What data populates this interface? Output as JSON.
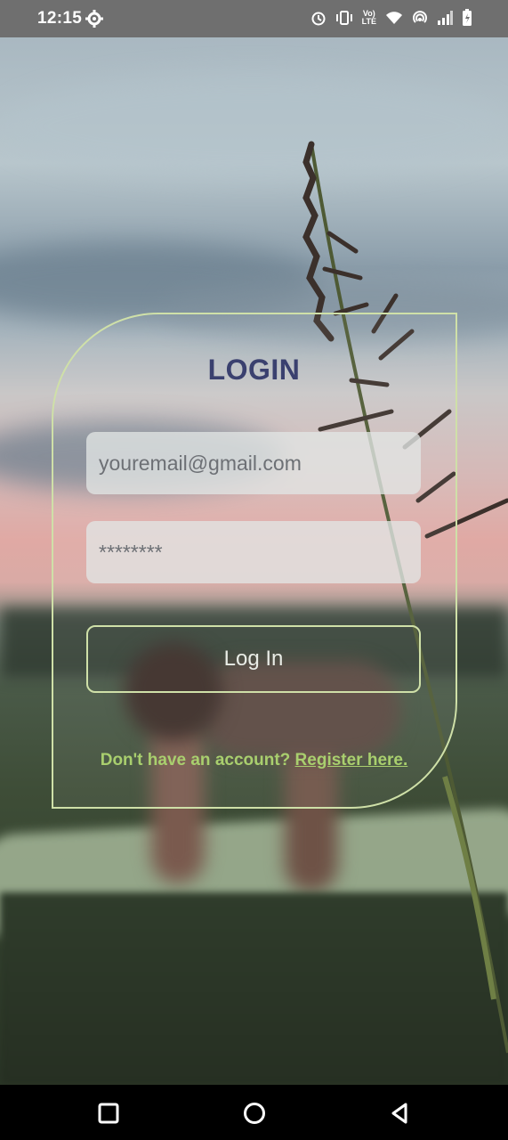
{
  "status_bar": {
    "time": "12:15",
    "icons": [
      "settings-icon",
      "alarm-icon",
      "vibrate-icon",
      "volte-icon",
      "wifi-icon",
      "hotspot-icon",
      "signal-icon",
      "battery-charging-icon"
    ],
    "volte_label_top": "Vo)",
    "volte_label_bottom": "LTE"
  },
  "login": {
    "title": "LOGIN",
    "email_placeholder": "youremail@gmail.com",
    "password_placeholder": "********",
    "login_button_label": "Log In",
    "register_prompt": "Don't have an account? ",
    "register_link": "Register here."
  },
  "colors": {
    "title": "#3a406f",
    "accent_border": "#cfe0a8",
    "register_text": "#a9cf6e",
    "status_bar_bg": "#6f6f6f"
  },
  "nav_bar": {
    "buttons": [
      "recents-icon",
      "home-icon",
      "back-icon"
    ]
  }
}
